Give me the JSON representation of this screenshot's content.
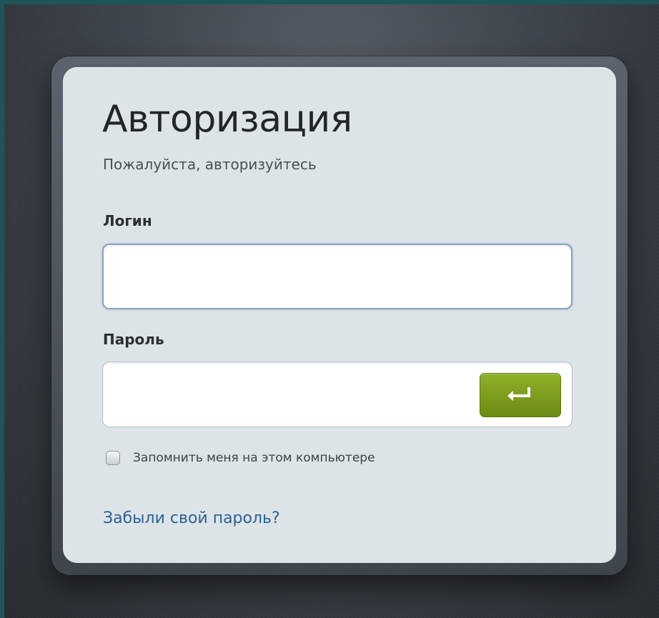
{
  "login_form": {
    "title": "Авторизация",
    "subtitle": "Пожалуйста, авторизуйтесь",
    "login": {
      "label": "Логин",
      "value": "",
      "placeholder": ""
    },
    "password": {
      "label": "Пароль",
      "value": "",
      "placeholder": ""
    },
    "submit": {
      "icon": "enter-return-icon",
      "color": "#7a9c1c"
    },
    "remember_me": {
      "label": "Запомнить меня на этом компьютере",
      "checked": false
    },
    "forgot_link": "Забыли свой пароль?",
    "colors": {
      "link": "#2d5f93",
      "card_background": "#dde4e8",
      "page_background": "#3f454c"
    }
  }
}
